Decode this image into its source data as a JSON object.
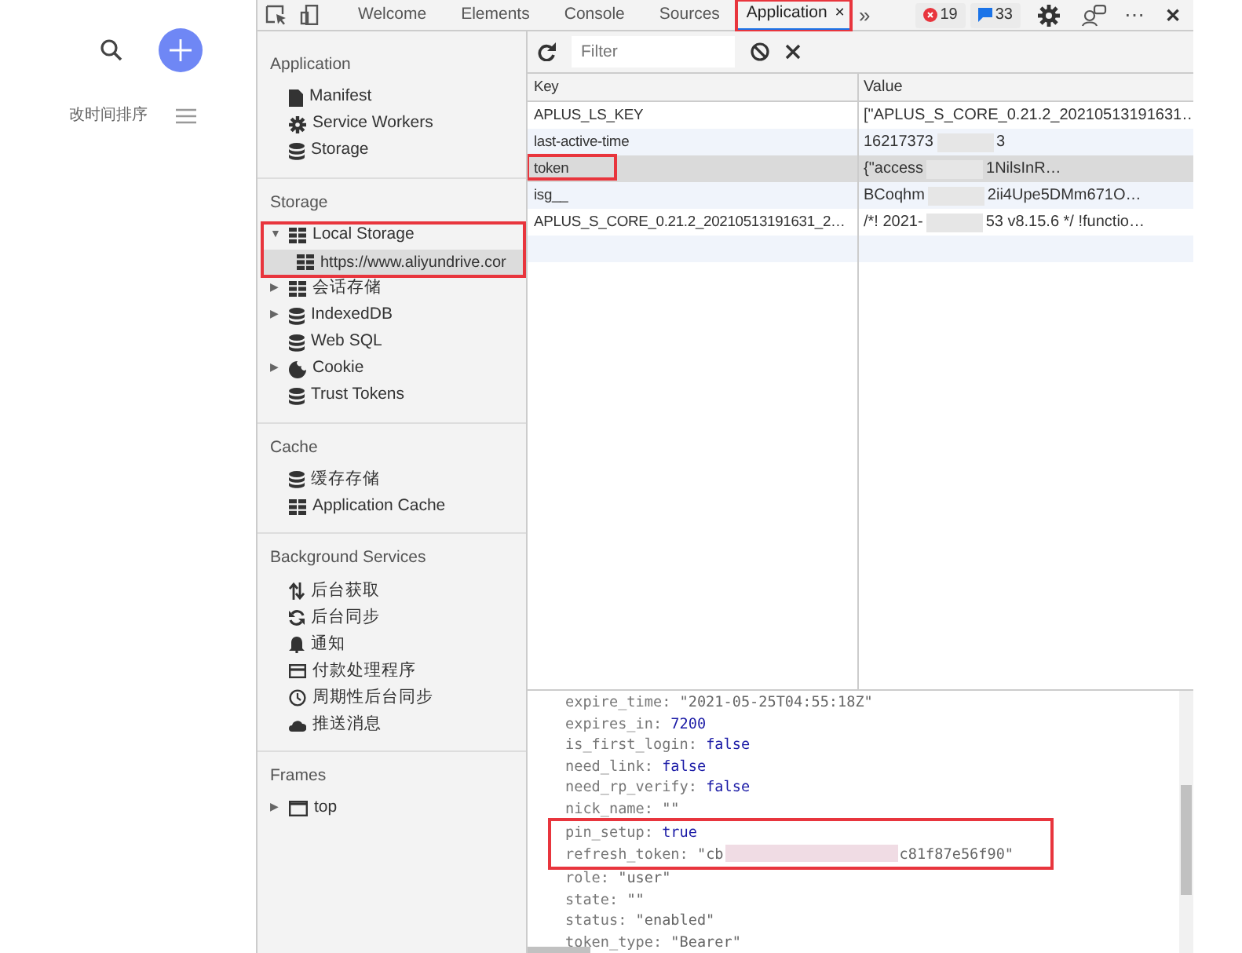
{
  "page": {
    "sort_label": "改时间排序"
  },
  "toolbar": {
    "tabs": [
      {
        "label": "Welcome",
        "selected": false,
        "highlighted": false
      },
      {
        "label": "Elements",
        "selected": false,
        "highlighted": false
      },
      {
        "label": "Console",
        "selected": false,
        "highlighted": false
      },
      {
        "label": "Sources",
        "selected": false,
        "highlighted": false
      },
      {
        "label": "Application",
        "close": "×",
        "selected": true,
        "highlighted": true
      }
    ],
    "more": "»",
    "errors": "19",
    "messages": "33",
    "menu": "⋯",
    "close": "✕"
  },
  "sidebar": {
    "sections": [
      {
        "title": "Application",
        "items": [
          {
            "label": "Manifest",
            "kind": "file",
            "selected": false,
            "highlighted": false
          },
          {
            "label": "Service Workers",
            "kind": "gear",
            "selected": false,
            "highlighted": false
          },
          {
            "label": "Storage",
            "kind": "db",
            "selected": false,
            "highlighted": false
          }
        ]
      },
      {
        "title": "Storage",
        "items": [
          {
            "label": "Local Storage",
            "kind": "grid",
            "toggle": "▼",
            "selected": false,
            "highlighted": true,
            "children": [
              {
                "label": "https://www.aliyundrive.cor",
                "kind": "grid",
                "selected": true
              }
            ]
          },
          {
            "label": "会话存储",
            "kind": "grid",
            "toggle": "▶",
            "selected": false,
            "highlighted": false
          },
          {
            "label": "IndexedDB",
            "kind": "db",
            "toggle": "▶",
            "selected": false,
            "highlighted": false
          },
          {
            "label": "Web SQL",
            "kind": "db",
            "selected": false,
            "highlighted": false
          },
          {
            "label": "Cookie",
            "kind": "cookie",
            "toggle": "▶",
            "selected": false,
            "highlighted": false
          },
          {
            "label": "Trust Tokens",
            "kind": "db",
            "selected": false,
            "highlighted": false
          }
        ]
      },
      {
        "title": "Cache",
        "items": [
          {
            "label": "缓存存储",
            "kind": "db",
            "selected": false,
            "highlighted": false
          },
          {
            "label": "Application Cache",
            "kind": "grid",
            "selected": false,
            "highlighted": false
          }
        ]
      },
      {
        "title": "Background Services",
        "items": [
          {
            "label": "后台获取",
            "kind": "updown",
            "selected": false,
            "highlighted": false
          },
          {
            "label": "后台同步",
            "kind": "sync",
            "selected": false,
            "highlighted": false
          },
          {
            "label": "通知",
            "kind": "bell",
            "selected": false,
            "highlighted": false
          },
          {
            "label": "付款处理程序",
            "kind": "card",
            "selected": false,
            "highlighted": false
          },
          {
            "label": "周期性后台同步",
            "kind": "clock",
            "selected": false,
            "highlighted": false
          },
          {
            "label": "推送消息",
            "kind": "cloud",
            "selected": false,
            "highlighted": false
          }
        ]
      },
      {
        "title": "Frames",
        "items": [
          {
            "label": "top",
            "kind": "frame",
            "toggle": "▶",
            "selected": false,
            "highlighted": false
          }
        ]
      }
    ]
  },
  "storage": {
    "filter": {
      "placeholder": "Filter"
    },
    "table": {
      "columns": [
        "Key",
        "Value"
      ],
      "rows": [
        {
          "key": "APLUS_LS_KEY",
          "value": "[\"APLUS_S_CORE_0.21.2_20210513191631…",
          "redacted": false,
          "selected": false,
          "highlighted": false
        },
        {
          "key": "last-active-time",
          "value": "16217373",
          "value_tail": "3",
          "redacted": true,
          "selected": false,
          "highlighted": false
        },
        {
          "key": "token",
          "value": "{\"access",
          "value_tail": "1NilsInR…",
          "redacted": true,
          "selected": true,
          "highlighted": true
        },
        {
          "key": "isg__",
          "value": "BCoqhm",
          "value_tail": "2ii4Upe5DMm671O…",
          "redacted": true,
          "selected": false,
          "highlighted": false
        },
        {
          "key": "APLUS_S_CORE_0.21.2_20210513191631_2…",
          "value": "/*! 2021-",
          "value_tail": "53 v8.15.6 */ !functio…",
          "redacted": true,
          "selected": false,
          "highlighted": false
        }
      ]
    },
    "preview": [
      {
        "key": "expire_time:",
        "value": "\"2021-05-25T04:55:18Z\"",
        "kind": "string",
        "highlighted": false
      },
      {
        "key": "expires_in:",
        "value": "7200",
        "kind": "number",
        "highlighted": false
      },
      {
        "key": "is_first_login:",
        "value": "false",
        "kind": "boolean",
        "highlighted": false
      },
      {
        "key": "need_link:",
        "value": "false",
        "kind": "boolean",
        "highlighted": false
      },
      {
        "key": "need_rp_verify:",
        "value": "false",
        "kind": "boolean",
        "highlighted": false
      },
      {
        "key": "nick_name:",
        "value": "\"\"",
        "kind": "string",
        "highlighted": false
      },
      {
        "key": "pin_setup:",
        "value": "true",
        "kind": "boolean",
        "highlighted": true
      },
      {
        "key": "refresh_token:",
        "value": "\"cb",
        "value_tail": "c81f87e56f90\"",
        "kind": "string",
        "highlighted": true
      },
      {
        "key": "role:",
        "value": "\"user\"",
        "kind": "string",
        "highlighted": false
      },
      {
        "key": "state:",
        "value": "\"\"",
        "kind": "string",
        "highlighted": false
      },
      {
        "key": "status:",
        "value": "\"enabled\"",
        "kind": "string",
        "highlighted": false
      },
      {
        "key": "token_type:",
        "value": "\"Bearer\"",
        "kind": "string",
        "highlighted": false
      }
    ]
  }
}
